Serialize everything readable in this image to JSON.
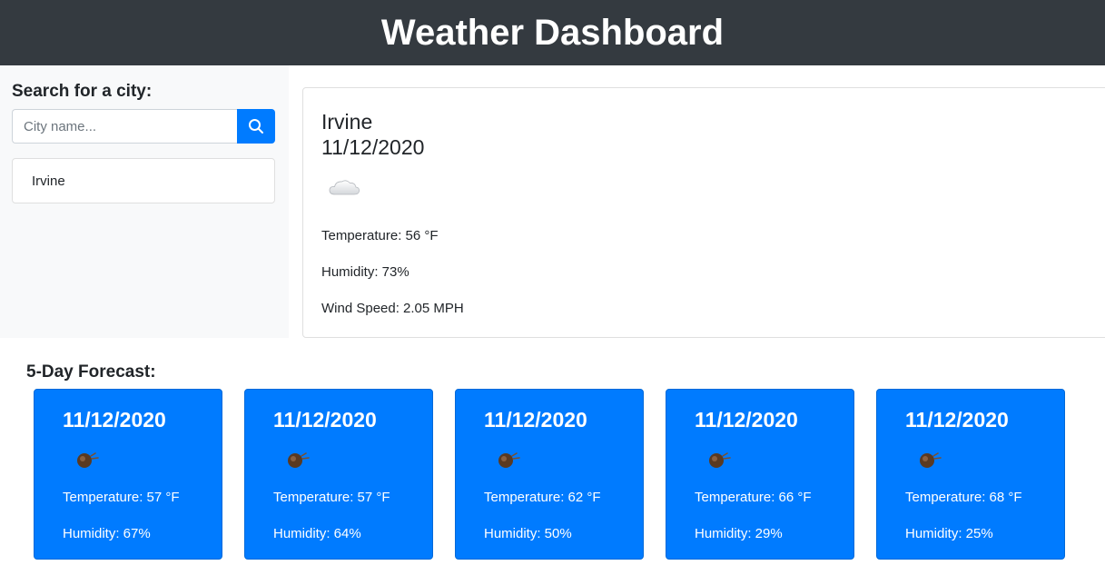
{
  "header": {
    "title": "Weather Dashboard"
  },
  "search": {
    "title": "Search for a city:",
    "placeholder": "City name...",
    "history": [
      "Irvine"
    ]
  },
  "current": {
    "city": "Irvine",
    "date": "11/12/2020",
    "icon": "cloud-icon",
    "temperature": "Temperature: 56 °F",
    "humidity": "Humidity: 73%",
    "wind": "Wind Speed: 2.05 MPH"
  },
  "forecast": {
    "title": "5-Day Forecast:",
    "days": [
      {
        "date": "11/12/2020",
        "icon": "weather-icon",
        "temperature": "Temperature: 57 °F",
        "humidity": "Humidity: 67%"
      },
      {
        "date": "11/12/2020",
        "icon": "weather-icon",
        "temperature": "Temperature: 57 °F",
        "humidity": "Humidity: 64%"
      },
      {
        "date": "11/12/2020",
        "icon": "weather-icon",
        "temperature": "Temperature: 62 °F",
        "humidity": "Humidity: 50%"
      },
      {
        "date": "11/12/2020",
        "icon": "weather-icon",
        "temperature": "Temperature: 66 °F",
        "humidity": "Humidity: 29%"
      },
      {
        "date": "11/12/2020",
        "icon": "weather-icon",
        "temperature": "Temperature: 68 °F",
        "humidity": "Humidity: 25%"
      }
    ]
  },
  "colors": {
    "header_bg": "#343a40",
    "accent": "#007bff",
    "sidebar_bg": "#f8f9fa"
  }
}
